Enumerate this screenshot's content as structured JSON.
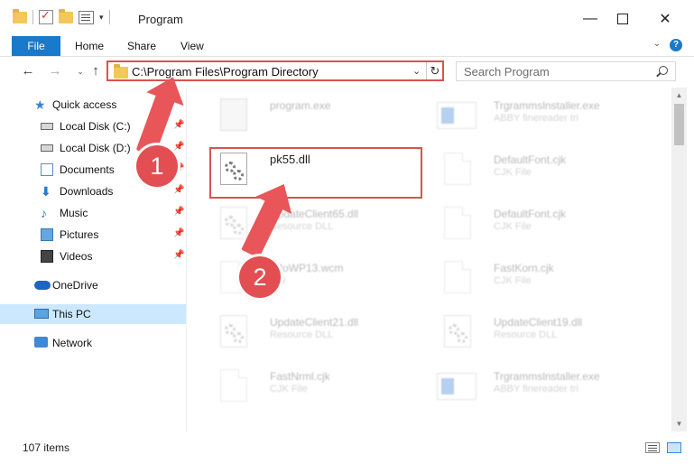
{
  "window": {
    "title": "Program"
  },
  "ribbon": {
    "tabs": [
      "File",
      "Home",
      "Share",
      "View"
    ]
  },
  "address": {
    "path": "C:\\Program Files\\Program Directory"
  },
  "search": {
    "placeholder": "Search Program"
  },
  "sidebar": {
    "items": [
      {
        "label": "Quick access",
        "icon": "star-icon",
        "pinned": false
      },
      {
        "label": "Local Disk (C:)",
        "icon": "disk-icon",
        "pinned": true
      },
      {
        "label": "Local Disk (D:)",
        "icon": "disk-icon",
        "pinned": true
      },
      {
        "label": "Documents",
        "icon": "documents-icon",
        "pinned": true
      },
      {
        "label": "Downloads",
        "icon": "download-icon",
        "pinned": true
      },
      {
        "label": "Music",
        "icon": "music-icon",
        "pinned": true
      },
      {
        "label": "Pictures",
        "icon": "pictures-icon",
        "pinned": true
      },
      {
        "label": "Videos",
        "icon": "videos-icon",
        "pinned": true
      },
      {
        "label": "OneDrive",
        "icon": "cloud-icon",
        "pinned": false
      },
      {
        "label": "This PC",
        "icon": "computer-icon",
        "pinned": false,
        "selected": true
      },
      {
        "label": "Network",
        "icon": "network-icon",
        "pinned": false
      }
    ]
  },
  "files": [
    {
      "name": "program.exe",
      "type": "",
      "icon": "exe-icon",
      "highlighted": false
    },
    {
      "name": "Trgrammslnstaller.exe",
      "type": "ABBY finereader tri",
      "icon": "installer-icon",
      "highlighted": false
    },
    {
      "name": "pk55.dll",
      "type": "",
      "icon": "dll-icon",
      "highlighted": true
    },
    {
      "name": "DefaultFont.cjk",
      "type": "CJK File",
      "icon": "file-icon",
      "highlighted": false
    },
    {
      "name": "UpdateClient65.dll",
      "type": "Resource DLL",
      "icon": "dll-icon",
      "highlighted": false
    },
    {
      "name": "DefaultFont.cjk",
      "type": "CJK File",
      "icon": "file-icon",
      "highlighted": false
    },
    {
      "name": "F2oWP13.wcm",
      "type": "File",
      "icon": "file-icon",
      "highlighted": false
    },
    {
      "name": "FastKorn.cjk",
      "type": "CJK File",
      "icon": "file-icon",
      "highlighted": false
    },
    {
      "name": "UpdateClient21.dll",
      "type": "Resource DLL",
      "icon": "dll-icon",
      "highlighted": false
    },
    {
      "name": "UpdateClient19.dll",
      "type": "Resource DLL",
      "icon": "dll-icon",
      "highlighted": false
    },
    {
      "name": "FastNrml.cjk",
      "type": "CJK File",
      "icon": "file-icon",
      "highlighted": false
    },
    {
      "name": "Trgrammslnstaller.exe",
      "type": "ABBY finereader tri",
      "icon": "installer-icon",
      "highlighted": false
    }
  ],
  "status": {
    "item_count": "107 items"
  },
  "annotations": {
    "step1": "1",
    "step2": "2",
    "accent": "#e24e52"
  },
  "colors": {
    "file_tab": "#1979ca",
    "selection": "#cce8ff",
    "highlight_box": "#d9534f"
  }
}
